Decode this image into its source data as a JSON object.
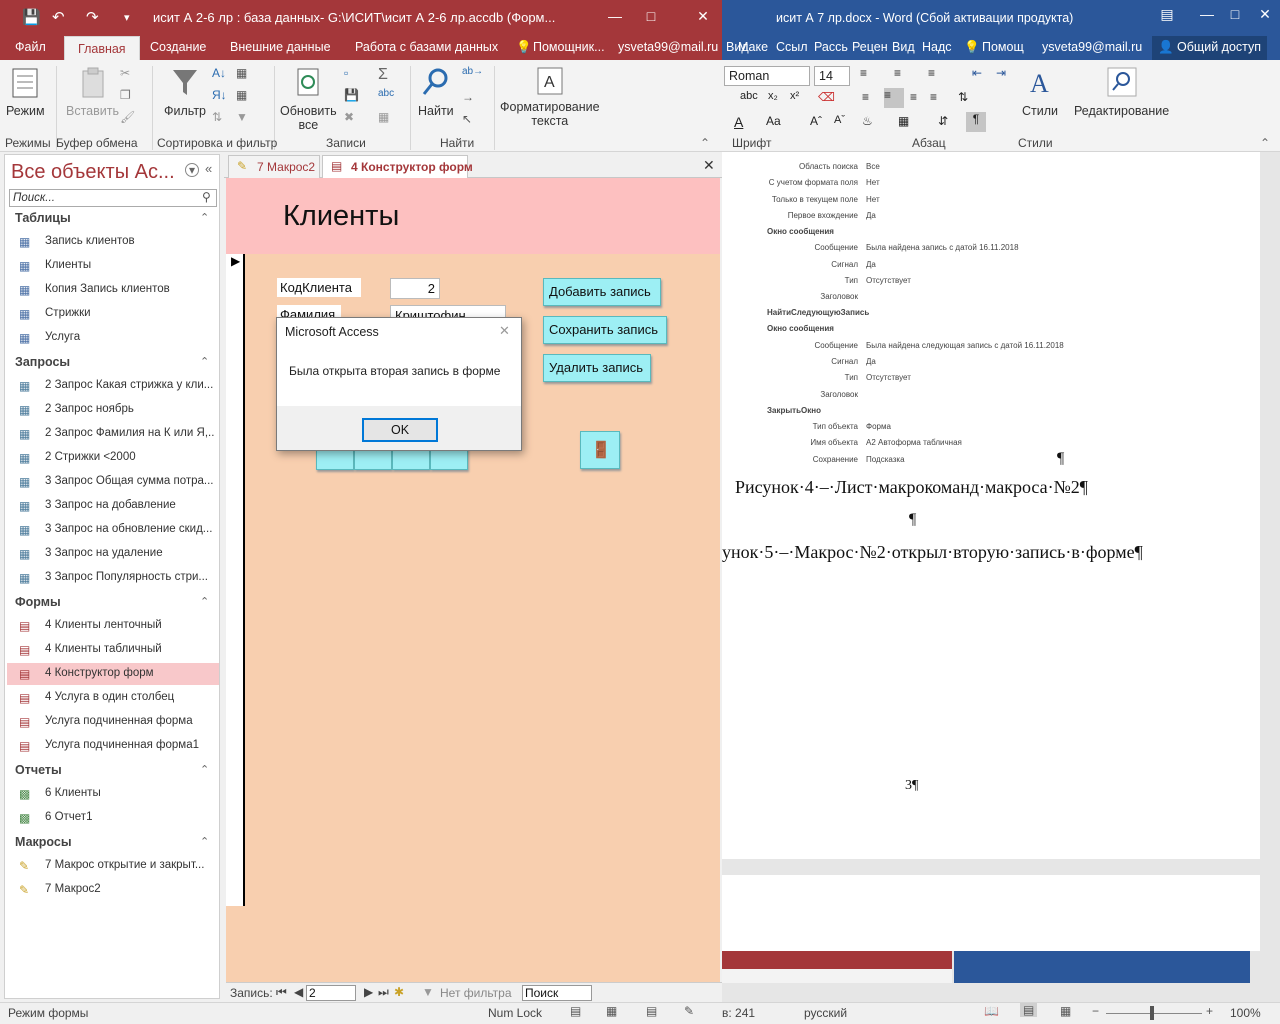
{
  "access": {
    "window_title": "исит А 2-6 лр : база данных- G:\\ИСИТ\\исит А 2-6 лр.accdb (Форм...",
    "tabs": [
      "Файл",
      "Главная",
      "Создание",
      "Внешние данные",
      "Работа с базами данных",
      "Помощник...",
      "ysveta99@mail.ru"
    ],
    "ribbon": {
      "rezhim": "Режим",
      "vstavit": "Вставить",
      "filtr": "Фильтр",
      "obnovit": "Обновить",
      "vse": "все",
      "nayti": "Найти",
      "format": "Форматирование",
      "teksta": "текста",
      "groups": [
        "Режимы",
        "Буфер обмена",
        "Сортировка и фильтр",
        "Записи",
        "Найти"
      ]
    },
    "nav": {
      "title": "Все объекты Ас...",
      "search_placeholder": "Поиск...",
      "categories": {
        "tables": "Таблицы",
        "queries": "Запросы",
        "forms": "Формы",
        "reports": "Отчеты",
        "macros": "Макросы"
      },
      "tables": [
        "Запись клиентов",
        "Клиенты",
        "Копия Запись клиентов",
        "Стрижки",
        "Услуга"
      ],
      "queries": [
        "2 Запрос Какая стрижка у кли...",
        "2 Запрос ноябрь",
        "2 Запрос Фамилия на К или Я,...",
        "2 Стрижки <2000",
        "3 Запрос Общая сумма потра...",
        "3 Запрос на добавление",
        "3 Запрос на обновление скид...",
        "3 Запрос на удаление",
        "3 Запрос Популярность стри..."
      ],
      "forms": [
        "4 Клиенты ленточный",
        "4 Клиенты табличный",
        "4 Конструктор форм",
        "4 Услуга в один столбец",
        "Услуга подчиненная форма",
        "Услуга подчиненная форма1"
      ],
      "reports": [
        "6 Клиенты",
        "6 Отчет1"
      ],
      "macros": [
        "7 Макрос открытие и закрыт...",
        "7 Макрос2"
      ]
    },
    "doc_tabs": [
      "7 Макрос2",
      "4 Конструктор форм"
    ],
    "form": {
      "title": "Клиенты",
      "kod_label": "КодКлиента",
      "kod_value": "2",
      "fam_label": "Фамилия",
      "fam_value": "Криштофин",
      "btn_add": "Добавить запись",
      "btn_save": "Сохранить запись",
      "btn_delete": "Удалить запись"
    },
    "dialog": {
      "caption": "Microsoft Access",
      "message": "Была открыта вторая запись в форме",
      "ok": "OK"
    },
    "record_nav": {
      "label": "Запись:",
      "current": "2",
      "filter": "Нет фильтра",
      "search": "Поиск"
    },
    "status": {
      "mode": "Режим формы",
      "numlock": "Num Lock"
    }
  },
  "word": {
    "window_title": "исит А 7 лр.docx - Word (Сбой активации продукта)",
    "tabs": [
      "Вид",
      "Маке",
      "Ссыл",
      "Рассь",
      "Рецен",
      "Вид",
      "Надс",
      "Помощ",
      "ysveta99@mail.ru",
      "Общий доступ"
    ],
    "font_name": "Roman",
    "font_size": "14",
    "groups": [
      "Шрифт",
      "Абзац",
      "Стили"
    ],
    "styles_label": "Стили",
    "editing_label": "Редактирование",
    "macro_rows": [
      [
        "Область поиска",
        "Все"
      ],
      [
        "С учетом формата поля",
        "Нет"
      ],
      [
        "Только в текущем поле",
        "Нет"
      ],
      [
        "Первое вхождение",
        "Да"
      ],
      [
        "Окно сообщения",
        ""
      ],
      [
        "Сообщение",
        "Была найдена запись с датой 16.11.2018"
      ],
      [
        "Сигнал",
        "Да"
      ],
      [
        "Тип",
        "Отсутствует"
      ],
      [
        "Заголовок",
        ""
      ],
      [
        "НайтиСледующуюЗапись",
        ""
      ],
      [
        "Окно сообщения",
        ""
      ],
      [
        "Сообщение",
        "Была найдена следующая запись с датой 16.11.2018"
      ],
      [
        "Сигнал",
        "Да"
      ],
      [
        "Тип",
        "Отсутствует"
      ],
      [
        "Заголовок",
        ""
      ],
      [
        "ЗакрытьОкно",
        ""
      ],
      [
        "Тип объекта",
        "Форма"
      ],
      [
        "Имя объекта",
        "А2 Автоформа табличная"
      ],
      [
        "Сохранение",
        "Подсказка"
      ]
    ],
    "para1": "¶",
    "caption4": "Рисунок·4·–·Лист·макрокоманд·макроса·№2¶",
    "para2": "¶",
    "caption5": "унок·5·–·Макрос·№2·открыл·вторую·запись·в·форме¶",
    "page_num": "3¶",
    "status": {
      "words": "в: 241",
      "lang": "русский",
      "zoom": "100%"
    }
  }
}
